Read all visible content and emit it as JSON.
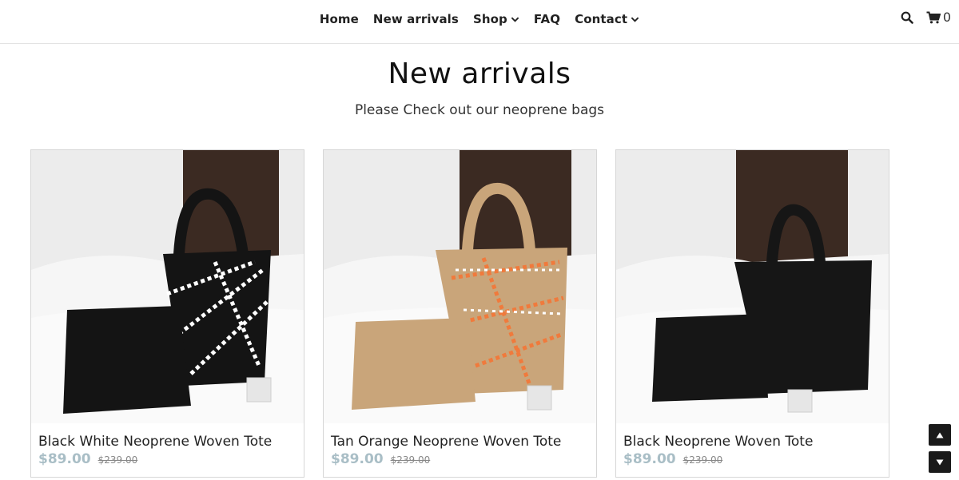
{
  "nav": {
    "items": [
      {
        "label": "Home",
        "has_dropdown": false
      },
      {
        "label": "New arrivals",
        "has_dropdown": false
      },
      {
        "label": "Shop",
        "has_dropdown": true
      },
      {
        "label": "FAQ",
        "has_dropdown": false
      },
      {
        "label": "Contact",
        "has_dropdown": true
      }
    ],
    "search_icon": "search-icon",
    "cart_icon": "shopping-cart-icon",
    "cart_count": "0"
  },
  "page": {
    "title": "New arrivals",
    "subtitle": "Please Check out our neoprene bags"
  },
  "products": [
    {
      "name": "Black White Neoprene Woven Tote",
      "price": "$89.00",
      "compare_price": "$239.00",
      "colors": {
        "bag": "#141414",
        "accent": "#ffffff"
      }
    },
    {
      "name": "Tan Orange Neoprene Woven Tote",
      "price": "$89.00",
      "compare_price": "$239.00",
      "colors": {
        "bag": "#c9a57a",
        "accent": "#f07a3c"
      }
    },
    {
      "name": "Black Neoprene Woven Tote",
      "price": "$89.00",
      "compare_price": "$239.00",
      "colors": {
        "bag": "#161616",
        "accent": "#161616"
      }
    }
  ],
  "colors": {
    "price_accent": "#a9bec6",
    "text": "#222222",
    "scroll_button": "#1a1a1a"
  },
  "scroll": {
    "up_icon": "triangle-up-icon",
    "down_icon": "triangle-down-icon"
  }
}
